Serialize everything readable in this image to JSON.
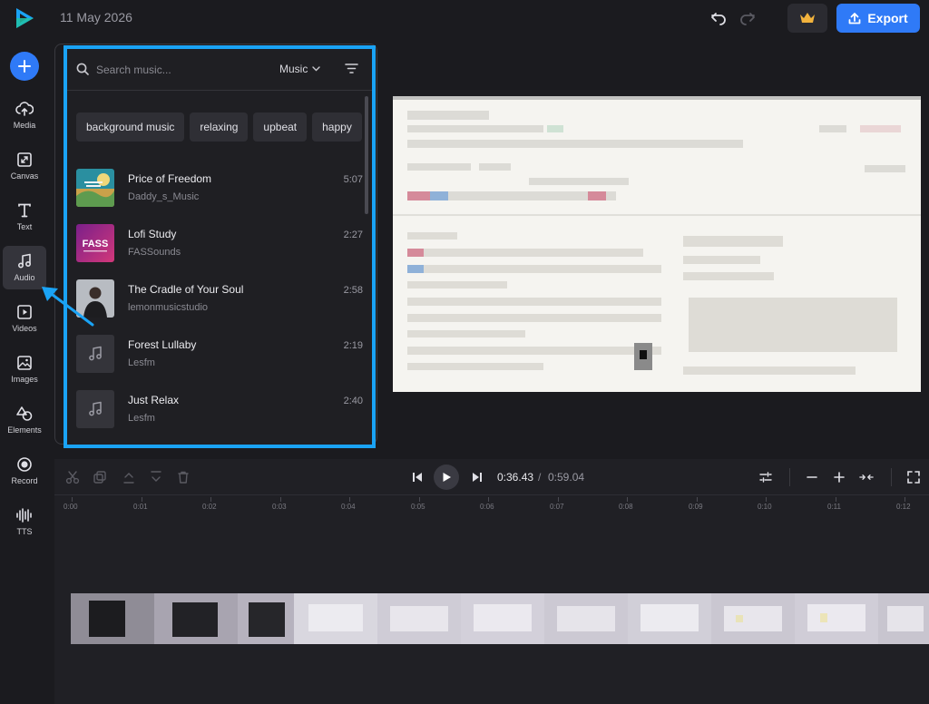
{
  "header": {
    "date": "11 May 2026",
    "export_label": "Export"
  },
  "sidebar": {
    "items": [
      {
        "label": "Media",
        "icon": "cloud-upload-icon"
      },
      {
        "label": "Canvas",
        "icon": "canvas-resize-icon"
      },
      {
        "label": "Text",
        "icon": "text-icon"
      },
      {
        "label": "Audio",
        "icon": "music-note-icon",
        "active": true
      },
      {
        "label": "Videos",
        "icon": "video-icon"
      },
      {
        "label": "Images",
        "icon": "image-icon"
      },
      {
        "label": "Elements",
        "icon": "shapes-icon"
      },
      {
        "label": "Record",
        "icon": "record-icon"
      },
      {
        "label": "TTS",
        "icon": "waveform-icon"
      }
    ]
  },
  "music_panel": {
    "search_placeholder": "Search music...",
    "category": "Music",
    "chips": [
      "background music",
      "relaxing",
      "upbeat",
      "happy"
    ],
    "tracks": [
      {
        "title": "Price of Freedom",
        "artist": "Daddy_s_Music",
        "duration": "5:07",
        "thumb": "art-freedom"
      },
      {
        "title": "Lofi Study",
        "artist": "FASSounds",
        "duration": "2:27",
        "thumb": "art-fass"
      },
      {
        "title": "The Cradle of Your Soul",
        "artist": "lemonmusicstudio",
        "duration": "2:58",
        "thumb": "art-portrait"
      },
      {
        "title": "Forest Lullaby",
        "artist": "Lesfm",
        "duration": "2:19",
        "thumb": "placeholder"
      },
      {
        "title": "Just Relax",
        "artist": "Lesfm",
        "duration": "2:40",
        "thumb": "placeholder"
      }
    ]
  },
  "timeline": {
    "current_time": "0:36.43",
    "separator": "/",
    "total_time": "0:59.04",
    "ruler_ticks": [
      "0:00",
      "0:01",
      "0:02",
      "0:03",
      "0:04",
      "0:05",
      "0:06",
      "0:07",
      "0:08",
      "0:09",
      "0:10",
      "0:11",
      "0:12"
    ]
  },
  "colors": {
    "accent": "#2f7af7",
    "highlight": "#1aa3f5",
    "crown": "#f2b33d"
  }
}
